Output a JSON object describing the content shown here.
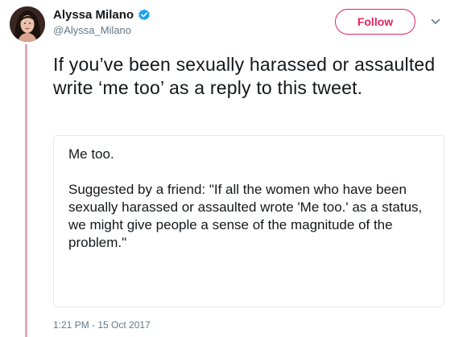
{
  "author": {
    "display_name": "Alyssa Milano",
    "handle": "@Alyssa_Milano",
    "verified": true,
    "avatar_icon": "profile-photo"
  },
  "follow_button": {
    "label": "Follow",
    "color": "#e0245e"
  },
  "menu": {
    "icon": "chevron-down-icon"
  },
  "tweet": {
    "text": "If you’ve been sexually harassed or assaulted write ‘me too’ as a reply to this tweet."
  },
  "quote_card": {
    "line1": "Me too.",
    "body": "Suggested by a friend: \"If all the women who have been sexually harassed or assaulted wrote 'Me too.' as a status, we might give people a sense of the magnitude of the problem.\""
  },
  "timestamp": "1:21 PM - 15 Oct 2017",
  "colors": {
    "verified_badge": "#1da1f2",
    "thread_line": "#e2a8b8",
    "secondary_text": "#657786"
  }
}
